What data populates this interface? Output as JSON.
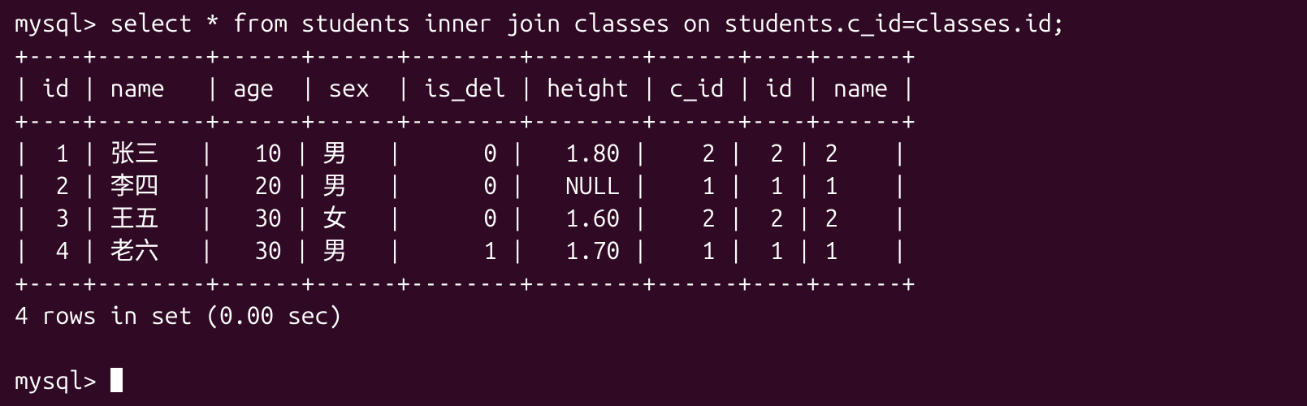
{
  "prompt1": "mysql> ",
  "query": "select * from students inner join classes on students.c_id=classes.id;",
  "table": {
    "border_top": "+----+--------+------+------+--------+--------+------+----+------+",
    "header": "| id | name   | age  | sex  | is_del | height | c_id | id | name |",
    "border_mid": "+----+--------+------+------+--------+--------+------+----+------+",
    "rows": [
      "|  1 | 张三   |   10 | 男   |      0 |   1.80 |    2 |  2 | 2    |",
      "|  2 | 李四   |   20 | 男   |      0 |   NULL |    1 |  1 | 1    |",
      "|  3 | 王五   |   30 | 女   |      0 |   1.60 |    2 |  2 | 2    |",
      "|  4 | 老六   |   30 | 男   |      1 |   1.70 |    1 |  1 | 1    |"
    ],
    "border_bot": "+----+--------+------+------+--------+--------+------+----+------+"
  },
  "summary": "4 rows in set (0.00 sec)",
  "blank": "",
  "prompt2": "mysql> ",
  "chart_data": {
    "type": "table",
    "columns": [
      "id",
      "name",
      "age",
      "sex",
      "is_del",
      "height",
      "c_id",
      "id",
      "name"
    ],
    "rows": [
      [
        1,
        "张三",
        10,
        "男",
        0,
        1.8,
        2,
        2,
        "2"
      ],
      [
        2,
        "李四",
        20,
        "男",
        0,
        null,
        1,
        1,
        "1"
      ],
      [
        3,
        "王五",
        30,
        "女",
        0,
        1.6,
        2,
        2,
        "2"
      ],
      [
        4,
        "老六",
        30,
        "男",
        1,
        1.7,
        1,
        1,
        "1"
      ]
    ],
    "row_count": 4,
    "elapsed_sec": 0.0
  }
}
